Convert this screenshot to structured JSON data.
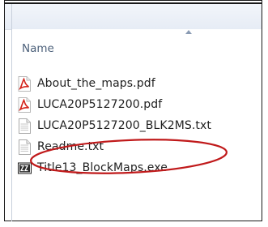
{
  "columns": {
    "name_label": "Name"
  },
  "files": [
    {
      "label": "About_the_maps.pdf",
      "icon": "pdf-icon"
    },
    {
      "label": "LUCA20P5127200.pdf",
      "icon": "pdf-icon"
    },
    {
      "label": "LUCA20P5127200_BLK2MS.txt",
      "icon": "text-file-icon"
    },
    {
      "label": "Readme.txt",
      "icon": "text-file-icon"
    },
    {
      "label": "Title13_BlockMaps.exe",
      "icon": "executable-icon"
    }
  ],
  "highlight": {
    "color": "#c0191a"
  }
}
